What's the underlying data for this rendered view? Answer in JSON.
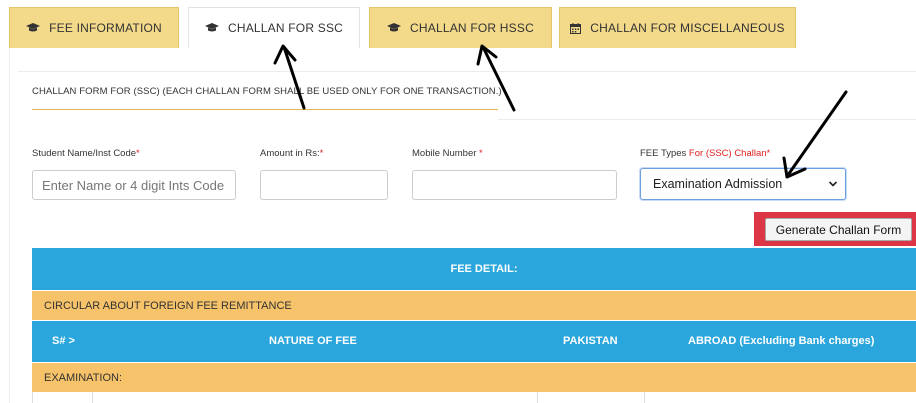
{
  "tabs": [
    {
      "label": "FEE INFORMATION",
      "icon": "graduation-cap-icon",
      "active": false
    },
    {
      "label": "CHALLAN FOR SSC",
      "icon": "graduation-cap-icon",
      "active": true
    },
    {
      "label": "CHALLAN FOR HSSC",
      "icon": "graduation-cap-icon",
      "active": false
    },
    {
      "label": "CHALLAN FOR MISCELLANEOUS",
      "icon": "calendar-icon",
      "active": false
    }
  ],
  "form": {
    "note": "CHALLAN FORM FOR (SSC) (EACH CHALLAN FORM SHALL BE USED ONLY FOR ONE TRANSACTION.)",
    "student": {
      "label": "Student Name/Inst Code",
      "required_mark": "*",
      "placeholder": "Enter Name or 4 digit Ints Code",
      "value": ""
    },
    "amount": {
      "label": "Amount in Rs:",
      "required_mark": "*",
      "value": ""
    },
    "mobile": {
      "label": "Mobile Number",
      "required_mark": " *",
      "value": ""
    },
    "fee_type": {
      "label": "FEE Types",
      "label_highlight": " For (SSC) Challan",
      "required_mark": "*",
      "selected": "Examination Admission"
    },
    "generate_label": "Generate Challan Form"
  },
  "table": {
    "title": "FEE DETAIL:",
    "circular": "CIRCULAR ABOUT FOREIGN FEE REMITTANCE",
    "columns": [
      "S# >",
      "NATURE OF FEE",
      "PAKISTAN",
      "ABROAD (Excluding Bank charges)"
    ],
    "section": "EXAMINATION:"
  },
  "colors": {
    "tab_bg": "#f3d98a",
    "header_blue": "#2aa6dd",
    "band_orange": "#f7c36a",
    "highlight_red": "#dc3545"
  }
}
